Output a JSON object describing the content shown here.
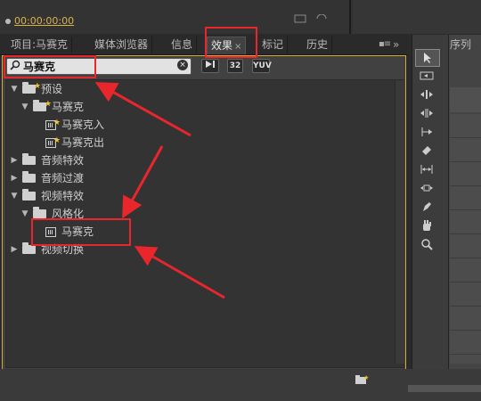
{
  "top": {
    "timecode": "00:00:00:00"
  },
  "tabs": [
    {
      "label": "项目:马赛克"
    },
    {
      "label": "媒体浏览器"
    },
    {
      "label": "信息"
    },
    {
      "label": "效果",
      "active": true,
      "close": "×"
    },
    {
      "label": "标记"
    },
    {
      "label": "历史"
    }
  ],
  "tab_more": "»",
  "search": {
    "value": "马赛克",
    "clear": "×"
  },
  "filters": [
    {
      "label": "32"
    },
    {
      "label": "YUV"
    }
  ],
  "tree": [
    {
      "label": "预设",
      "expanded": true,
      "kind": "folder-star"
    },
    {
      "label": "马赛克",
      "expanded": true,
      "kind": "folder-star"
    },
    {
      "label": "马赛克入",
      "kind": "effect-star"
    },
    {
      "label": "马赛克出",
      "kind": "effect-star"
    },
    {
      "label": "音频特效",
      "kind": "folder"
    },
    {
      "label": "音频过渡",
      "kind": "folder"
    },
    {
      "label": "视频特效",
      "expanded": true,
      "kind": "folder"
    },
    {
      "label": "风格化",
      "expanded": true,
      "kind": "folder"
    },
    {
      "label": "马赛克",
      "kind": "effect"
    },
    {
      "label": "视频切换",
      "kind": "folder"
    }
  ],
  "sequence": {
    "tab": "序列"
  },
  "colors": {
    "highlight": "#e8262c",
    "panel_border": "#d6a93a",
    "timecode": "#d7b34a",
    "star": "#f3c534"
  }
}
